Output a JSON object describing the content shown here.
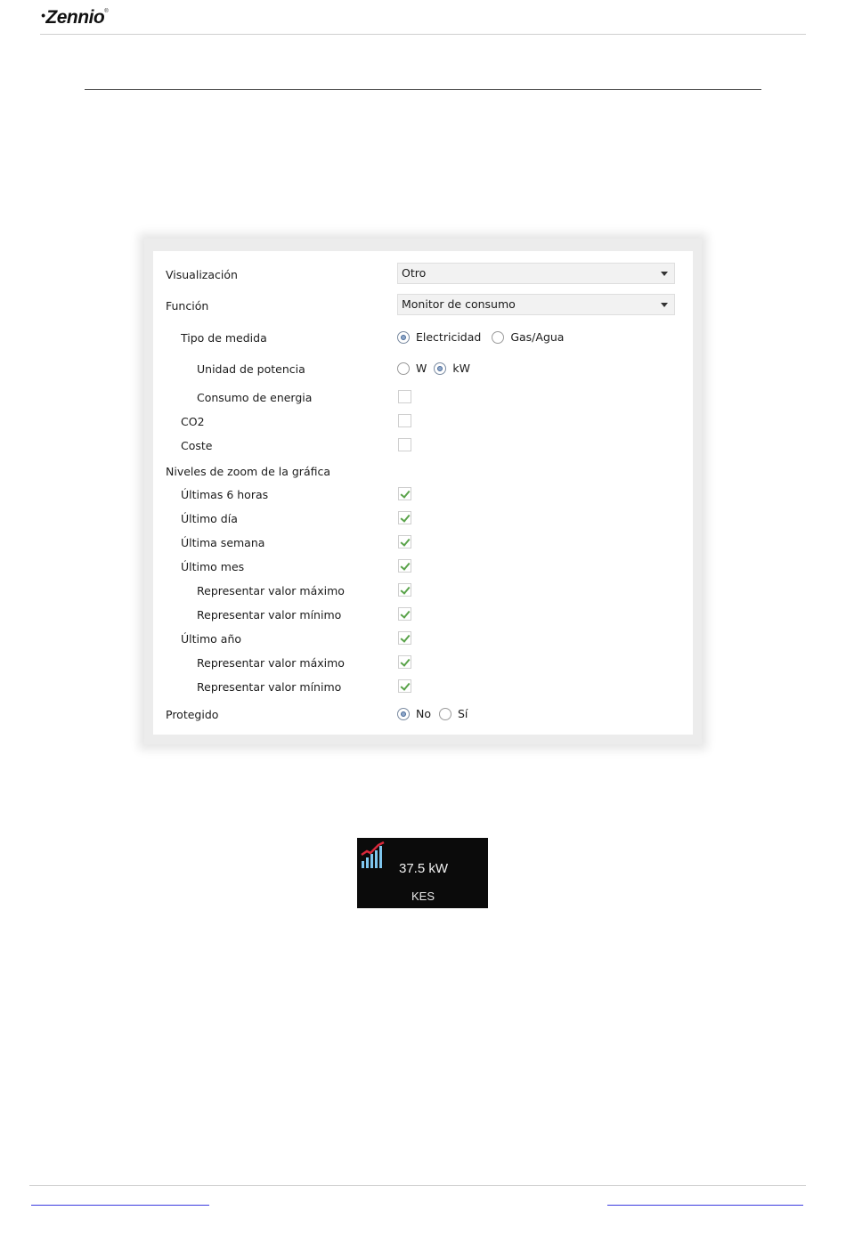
{
  "header": {
    "logo_text": "Zennio"
  },
  "panel": {
    "visualizacion": {
      "label": "Visualización",
      "value": "Otro"
    },
    "funcion": {
      "label": "Función",
      "value": "Monitor de consumo"
    },
    "tipo_medida": {
      "label": "Tipo de medida",
      "options": [
        "Electricidad",
        "Gas/Agua"
      ],
      "selected": "Electricidad"
    },
    "unidad_potencia": {
      "label": "Unidad de potencia",
      "options": [
        "W",
        "kW"
      ],
      "selected": "kW"
    },
    "consumo_energia": {
      "label": "Consumo de energia",
      "checked": false
    },
    "co2": {
      "label": "CO2",
      "checked": false
    },
    "coste": {
      "label": "Coste",
      "checked": false
    },
    "zoom_heading": "Niveles de zoom de la gráfica",
    "ultimas_6h": {
      "label": "Últimas 6 horas",
      "checked": true
    },
    "ultimo_dia": {
      "label": "Último día",
      "checked": true
    },
    "ultima_semana": {
      "label": "Última semana",
      "checked": true
    },
    "ultimo_mes": {
      "label": "Último mes",
      "checked": true
    },
    "mes_max": {
      "label": "Representar valor máximo",
      "checked": true
    },
    "mes_min": {
      "label": "Representar valor mínimo",
      "checked": true
    },
    "ultimo_anio": {
      "label": "Último año",
      "checked": true
    },
    "anio_max": {
      "label": "Representar valor máximo",
      "checked": true
    },
    "anio_min": {
      "label": "Representar valor mínimo",
      "checked": true
    },
    "protegido": {
      "label": "Protegido",
      "options": [
        "No",
        "Sí"
      ],
      "selected": "No"
    }
  },
  "widget": {
    "value": "37.5 kW",
    "name": "KES",
    "icon": "consumption-chart-icon"
  },
  "colors": {
    "check": "#5aa34a",
    "radio": "#8ea7c9",
    "widget_bg": "#0b0b0b",
    "link": "#3a3ae0"
  }
}
